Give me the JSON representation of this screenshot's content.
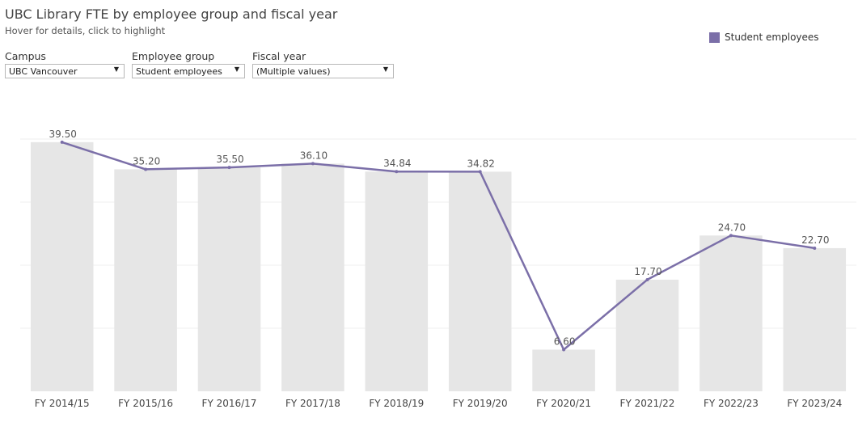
{
  "header": {
    "title": "UBC Library FTE by employee group and fiscal year",
    "subtitle": "Hover for details, click to highlight"
  },
  "filters": [
    {
      "label": "Campus",
      "value": "UBC Vancouver"
    },
    {
      "label": "Employee group",
      "value": "Student employees"
    },
    {
      "label": "Fiscal year",
      "value": "(Multiple values)"
    }
  ],
  "legend": {
    "label": "Student employees"
  },
  "colors": {
    "line": "#7b6fa8",
    "bar": "#e6e6e6",
    "grid": "#efefef"
  },
  "icons": {
    "dropdown": "triangle-down-icon"
  },
  "chart_data": {
    "type": "bar",
    "categories": [
      "FY 2014/15",
      "FY 2015/16",
      "FY 2016/17",
      "FY 2017/18",
      "FY 2018/19",
      "FY 2019/20",
      "FY 2020/21",
      "FY 2021/22",
      "FY 2022/23",
      "FY 2023/24"
    ],
    "series": [
      {
        "name": "Student employees",
        "type": "line",
        "values": [
          39.5,
          35.2,
          35.5,
          36.1,
          34.84,
          34.82,
          6.6,
          17.7,
          24.7,
          22.7
        ]
      }
    ],
    "bar_values": [
      39.5,
      35.2,
      35.5,
      36.1,
      34.84,
      34.82,
      6.6,
      17.7,
      24.7,
      22.7
    ],
    "data_labels": [
      "39.50",
      "35.20",
      "35.50",
      "36.10",
      "34.84",
      "34.82",
      "6.60",
      "17.70",
      "24.70",
      "22.70"
    ],
    "ylim": [
      0,
      40
    ],
    "grid": true,
    "legend_position": "top-right",
    "xlabel": "",
    "ylabel": ""
  }
}
